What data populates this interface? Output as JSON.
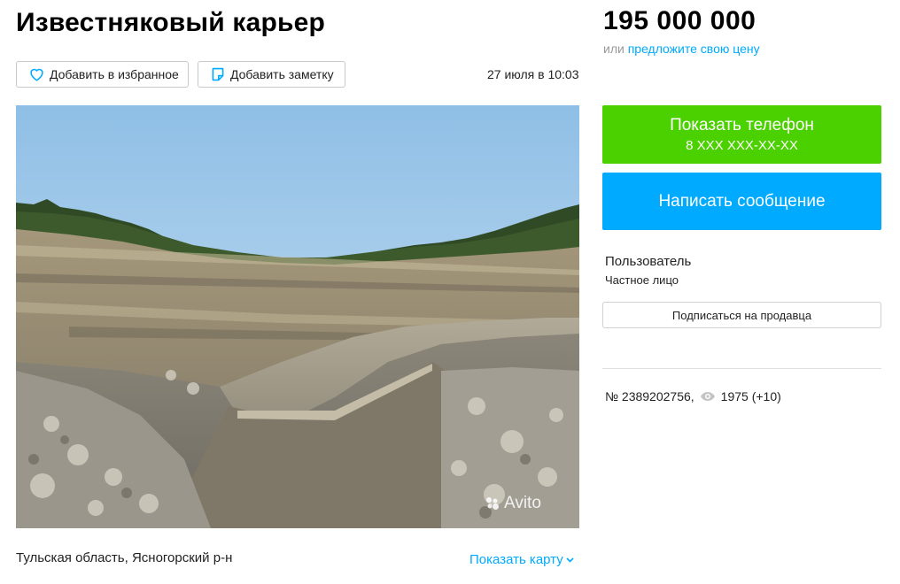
{
  "breadcrumbs": "···· ··········· ··· ······ ···········",
  "listing": {
    "title": "Известняковый карьер",
    "date": "27 июля в 10:03",
    "address": "Тульская область, Ясногорский р-н",
    "show_map": "Показать карту",
    "watermark": "Avito"
  },
  "actions": {
    "favorite": "Добавить в избранное",
    "note": "Добавить заметку"
  },
  "price": {
    "value": "195 000 000 ",
    "offer_prefix": "или",
    "offer_link": "предложите свою цену"
  },
  "contact": {
    "show_phone": "Показать телефон",
    "phone_mask": "8 XXX XXX-XX-XX",
    "write_message": "Написать сообщение"
  },
  "seller": {
    "name": "Пользователь",
    "type": "Частное лицо",
    "subscribe": "Подписаться на продавца"
  },
  "stats": {
    "ad_number": "№ 2389202756,",
    "views": "1975 (+10)"
  },
  "colors": {
    "green": "#4cd100",
    "blue": "#00aaff",
    "link": "#00aaff"
  }
}
